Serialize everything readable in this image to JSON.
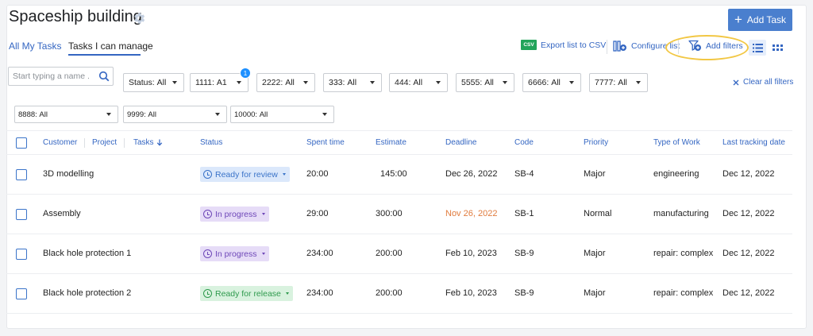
{
  "header": {
    "title": "Spaceship building",
    "add_task_label": "Add Task"
  },
  "tabs": [
    {
      "label": "All My Tasks"
    },
    {
      "label": "Tasks I can manage",
      "active": true
    }
  ],
  "toolbar": {
    "csv_icon_text": "CSV",
    "export_label": "Export list to CSV",
    "configure_label": "Configure list",
    "add_filters_label": "Add filters"
  },
  "search": {
    "placeholder": "Start typing a name ..."
  },
  "filters": [
    {
      "label": "Status:",
      "value": "All"
    },
    {
      "label": "1111:",
      "value": "A1",
      "badge": "1"
    },
    {
      "label": "2222:",
      "value": "All"
    },
    {
      "label": "333:",
      "value": "All"
    },
    {
      "label": "444:",
      "value": "All"
    },
    {
      "label": "5555:",
      "value": "All"
    },
    {
      "label": "6666:",
      "value": "All"
    },
    {
      "label": "7777:",
      "value": "All"
    },
    {
      "label": "8888:",
      "value": "All"
    },
    {
      "label": "9999:",
      "value": "All"
    },
    {
      "label": "10000:",
      "value": "All"
    }
  ],
  "clear_filters_label": "Clear all filters",
  "columns": [
    "Customer",
    "Project",
    "Tasks",
    "Status",
    "Spent time",
    "Estimate",
    "Deadline",
    "Code",
    "Priority",
    "Type of Work",
    "Last tracking date"
  ],
  "rows": [
    {
      "task": "3D modelling",
      "status": "Ready for review",
      "spent": "20:00",
      "estimate": "145:00",
      "deadline": "Dec 26, 2022",
      "code": "SB-4",
      "priority": "Major",
      "type": "engineering",
      "last": "Dec 12, 2022"
    },
    {
      "task": "Assembly",
      "status": "In progress",
      "spent": "29:00",
      "estimate": "300:00",
      "deadline": "Nov 26, 2022",
      "code": "SB-1",
      "priority": "Normal",
      "type": "manufacturing",
      "last": "Dec 12, 2022"
    },
    {
      "task": "Black hole protection 1",
      "status": "In progress",
      "spent": "234:00",
      "estimate": "200:00",
      "deadline": "Feb 10, 2023",
      "code": "SB-9",
      "priority": "Major",
      "type": "repair: complex",
      "last": "Dec 12, 2022"
    },
    {
      "task": "Black hole protection 2",
      "status": "Ready for release",
      "spent": "234:00",
      "estimate": "200:00",
      "deadline": "Feb 10, 2023",
      "code": "SB-9",
      "priority": "Major",
      "type": "repair: complex",
      "last": "Dec 12, 2022"
    }
  ],
  "colors": {
    "accent": "#3466c2",
    "add_task_bg": "#4a7fce",
    "highlight": "#f2c744",
    "overdue": "#e07b3d",
    "review_bg": "#dbe8fb",
    "review_fg": "#3a73c8",
    "progress_bg": "#e6dcf7",
    "progress_fg": "#6e47b8",
    "release_bg": "#d9f2df",
    "release_fg": "#2e9a4d"
  },
  "icons": [
    "gear-icon",
    "plus-icon",
    "csv-icon",
    "configure-list-icon",
    "add-filter-icon",
    "list-view-icon",
    "grid-view-icon",
    "search-icon",
    "close-icon",
    "sort-arrow-down-icon",
    "clock-icon",
    "chevron-down-icon"
  ]
}
